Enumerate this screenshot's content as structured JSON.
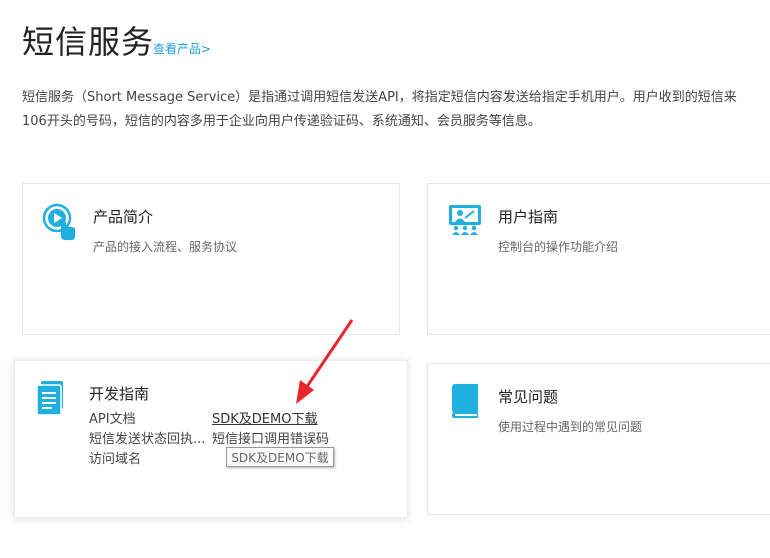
{
  "header": {
    "title": "短信服务",
    "product_link": "查看产品>"
  },
  "description": {
    "line1": "短信服务（Short Message Service）是指通过调用短信发送API，将指定短信内容发送给指定手机用户。用户收到的短信来",
    "line2": "106开头的号码，短信的内容多用于企业向用户传递验证码、系统通知、会员服务等信息。"
  },
  "cards": {
    "intro": {
      "icon": "touch-play-icon",
      "title": "产品简介",
      "subtitle": "产品的接入流程、服务协议"
    },
    "guide": {
      "icon": "presentation-icon",
      "title": "用户指南",
      "subtitle": "控制台的操作功能介绍"
    },
    "dev": {
      "icon": "document-icon",
      "title": "开发指南",
      "links": [
        "API文档",
        "SDK及DEMO下载",
        "短信发送状态回执...",
        "短信接口调用错误码",
        "访问域名"
      ]
    },
    "faq": {
      "icon": "book-icon",
      "title": "常见问题",
      "subtitle": "使用过程中遇到的常见问题"
    }
  },
  "tooltip": "SDK及DEMO下载",
  "colors": {
    "accent": "#1e9fd9",
    "icon": "#20b0e0",
    "arrow": "#e8262b"
  }
}
